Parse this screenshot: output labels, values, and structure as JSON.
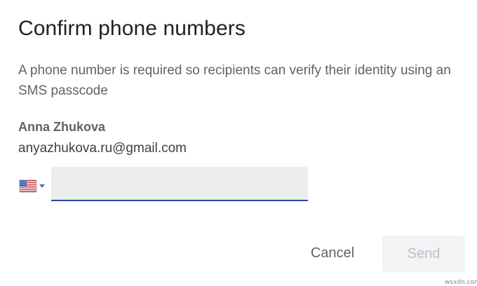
{
  "dialog": {
    "title": "Confirm phone numbers",
    "description": "A phone number is required so recipients can verify their identity using an SMS passcode"
  },
  "recipient": {
    "name": "Anna Zhukova",
    "email": "anyazhukova.ru@gmail.com"
  },
  "phone": {
    "country_flag_icon": "us-flag-icon",
    "value": "",
    "placeholder": ""
  },
  "actions": {
    "cancel_label": "Cancel",
    "send_label": "Send"
  },
  "watermark": "wsxdn.com",
  "colors": {
    "input_underline": "#1f4fa0",
    "send_disabled_bg": "#f1f3f4",
    "send_disabled_text": "#bdc1c6"
  }
}
